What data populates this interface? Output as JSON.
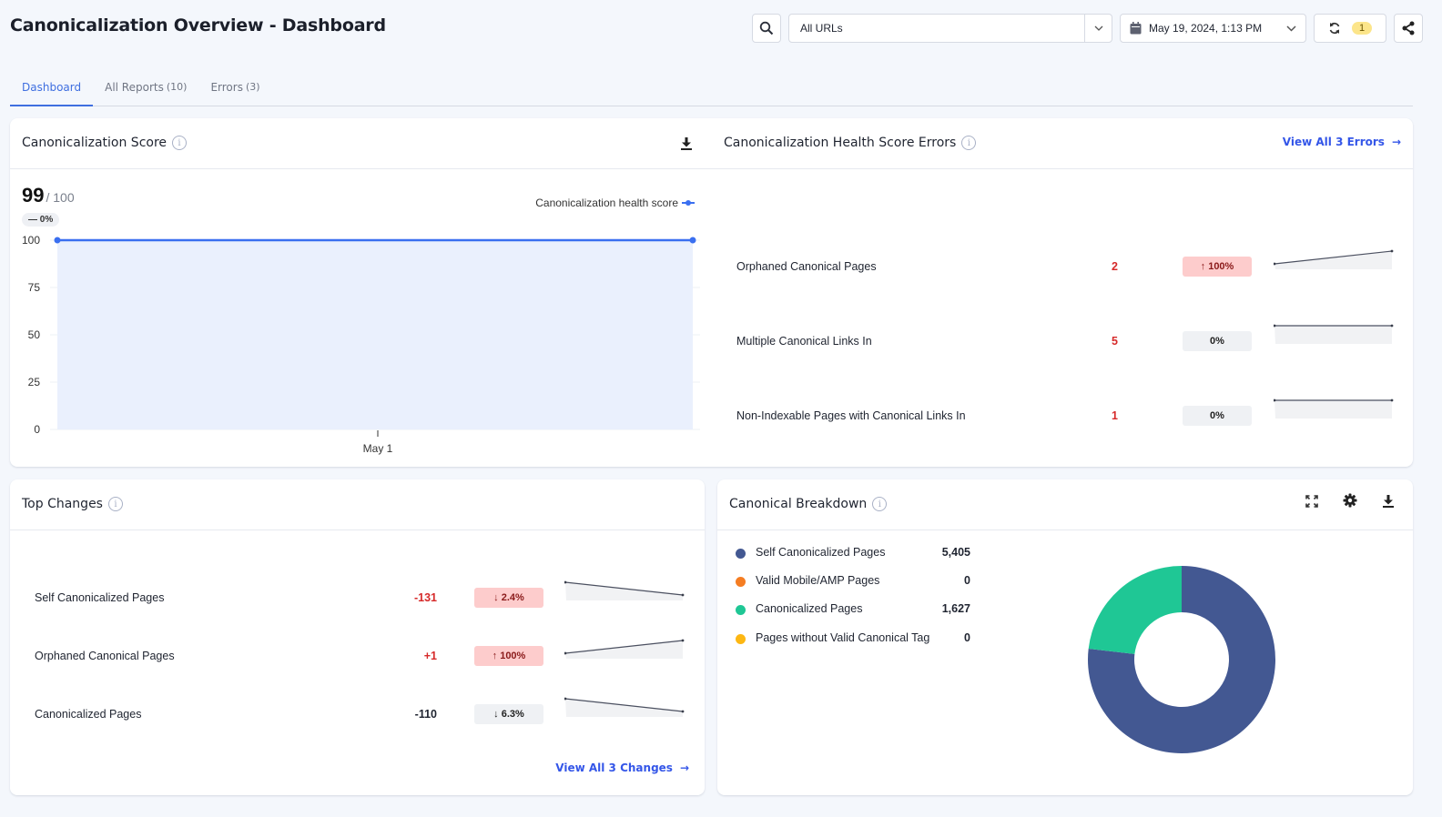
{
  "header": {
    "title": "Canonicalization Overview - Dashboard",
    "url_filter": "All URLs",
    "date": "May 19, 2024, 1:13 PM",
    "sync_count": "1"
  },
  "tabs": [
    {
      "label": "Dashboard",
      "count": ""
    },
    {
      "label": "All Reports",
      "count": "(10)"
    },
    {
      "label": "Errors",
      "count": "(3)"
    }
  ],
  "score_card": {
    "title": "Canonicalization Score",
    "score": "99",
    "score_max": "/ 100",
    "change": "— 0%"
  },
  "errors_card": {
    "title": "Canonicalization Health Score Errors",
    "view_all": "View All 3 Errors",
    "rows": [
      {
        "label": "Orphaned Canonical Pages",
        "value": "2",
        "change": "↑ 100%",
        "tone": "red",
        "trend": [
          1,
          2
        ]
      },
      {
        "label": "Multiple Canonical Links In",
        "value": "5",
        "change": "0%",
        "tone": "gray",
        "trend": [
          5,
          5
        ]
      },
      {
        "label": "Non-Indexable Pages with Canonical Links In",
        "value": "1",
        "change": "0%",
        "tone": "gray",
        "trend": [
          1,
          1
        ]
      }
    ]
  },
  "changes_card": {
    "title": "Top Changes",
    "view_all": "View All 3 Changes",
    "rows": [
      {
        "label": "Self Canonicalized Pages",
        "value": "-131",
        "value_color": "#d62a2a",
        "change": "↓ 2.4%",
        "tone": "red",
        "trend": [
          5536,
          5405
        ]
      },
      {
        "label": "Orphaned Canonical Pages",
        "value": "+1",
        "value_color": "#d62a2a",
        "change": "↑ 100%",
        "tone": "red",
        "trend": [
          1,
          2
        ]
      },
      {
        "label": "Canonicalized Pages",
        "value": "-110",
        "value_color": "#1f2430",
        "change": "↓ 6.3%",
        "tone": "gray",
        "trend": [
          1737,
          1627
        ]
      }
    ]
  },
  "breakdown_card": {
    "title": "Canonical Breakdown",
    "items": [
      {
        "label": "Self Canonicalized Pages",
        "value": "5,405",
        "raw": 5405,
        "color": "#435892"
      },
      {
        "label": "Valid Mobile/AMP Pages",
        "value": "0",
        "raw": 0,
        "color": "#f57d22"
      },
      {
        "label": "Canonicalized Pages",
        "value": "1,627",
        "raw": 1627,
        "color": "#1fc795"
      },
      {
        "label": "Pages without Valid Canonical Tag",
        "value": "0",
        "raw": 0,
        "color": "#fdb713"
      }
    ]
  },
  "chart_data": [
    {
      "type": "area",
      "title": "Canonicalization Score",
      "legend": [
        "Canonicalization health score"
      ],
      "legend_position": "top-right",
      "x": [
        "",
        "May 1",
        ""
      ],
      "series": [
        {
          "name": "Canonicalization health score",
          "values": [
            99,
            99
          ]
        }
      ],
      "x_tick_labels": [
        "May 1"
      ],
      "y_tick_labels": [
        "0",
        "25",
        "50",
        "75",
        "100"
      ],
      "ylim": [
        0,
        100
      ],
      "grid": true,
      "color": "#3a6ff0"
    },
    {
      "type": "pie",
      "title": "Canonical Breakdown",
      "categories": [
        "Self Canonicalized Pages",
        "Valid Mobile/AMP Pages",
        "Canonicalized Pages",
        "Pages without Valid Canonical Tag"
      ],
      "values": [
        5405,
        0,
        1627,
        0
      ],
      "donut": true
    }
  ],
  "colors": {
    "accent": "#3f6fe0",
    "link": "#3456e8",
    "error": "#d62a2a"
  }
}
